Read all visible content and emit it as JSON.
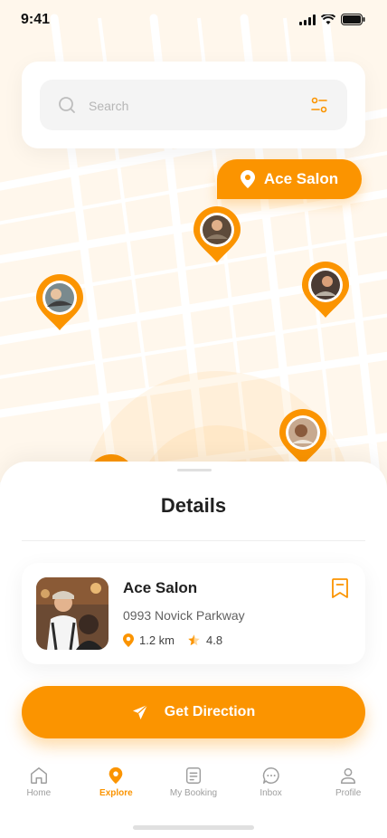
{
  "status_bar": {
    "time": "9:41"
  },
  "search": {
    "placeholder": "Search",
    "value": ""
  },
  "selected_chip": {
    "label": "Ace Salon"
  },
  "details": {
    "title": "Details",
    "salon": {
      "name": "Ace Salon",
      "address": "0993 Novick Parkway",
      "distance": "1.2 km",
      "rating": "4.8"
    },
    "action_label": "Get Direction"
  },
  "nav": {
    "items": [
      {
        "label": "Home",
        "icon": "home-icon"
      },
      {
        "label": "Explore",
        "icon": "location-pin-icon",
        "active": true
      },
      {
        "label": "My Booking",
        "icon": "document-icon"
      },
      {
        "label": "Inbox",
        "icon": "chat-icon"
      },
      {
        "label": "Profile",
        "icon": "user-icon"
      }
    ]
  },
  "colors": {
    "accent": "#FB9400",
    "map_bg": "#FFF9F1",
    "road": "#FFFFFF"
  }
}
